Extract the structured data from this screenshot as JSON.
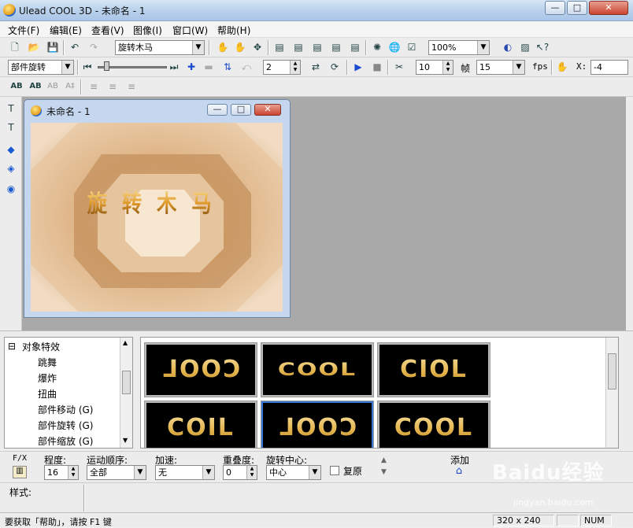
{
  "window": {
    "title": "Ulead COOL 3D - 未命名 - 1",
    "min_label": "—",
    "max_label": "□",
    "close_label": "✕"
  },
  "menu": [
    "文件(F)",
    "编辑(E)",
    "查看(V)",
    "图像(I)",
    "窗口(W)",
    "帮助(H)"
  ],
  "toolbar1": {
    "text_select": "旋转木马",
    "zoom_select": "100%"
  },
  "toolbar2": {
    "object_select": "部件旋转",
    "frame_value": "2",
    "frames_value": "10",
    "frames_label": "帧",
    "fps_value": "15",
    "fps_label": "fps",
    "x_label": "X:",
    "x_value": "-4"
  },
  "document": {
    "title": "未命名 - 1",
    "canvas_text": "旋转木马"
  },
  "tree": {
    "root": "对象特效",
    "items": [
      "跳舞",
      "爆炸",
      "扭曲",
      "部件移动 (G)",
      "部件旋转 (G)",
      "部件缩放 (G)"
    ]
  },
  "thumbnails": [
    "COOL",
    "COOL",
    "CIOL",
    "COIL",
    "COOL",
    "COOL"
  ],
  "props": {
    "fx_label": "F/X",
    "level_label": "程度:",
    "level_value": "16",
    "order_label": "运动顺序:",
    "order_value": "全部",
    "accel_label": "加速:",
    "accel_value": "无",
    "overlap_label": "重叠度:",
    "overlap_value": "0",
    "center_label": "旋转中心:",
    "center_value": "中心",
    "restore_label": "复原",
    "add_label": "添加"
  },
  "style": {
    "label": "样式:"
  },
  "status": {
    "help": "要获取「帮助」，请按 F1 键",
    "size": "320 x 240",
    "num": "NUM"
  },
  "watermark": {
    "brand": "Baidu经验",
    "url": "jingyan.baidu.com"
  },
  "colors": {
    "workspace": "#a9a9a9",
    "canvas": "#ddb891",
    "titlebar": "#bcd3ec"
  }
}
